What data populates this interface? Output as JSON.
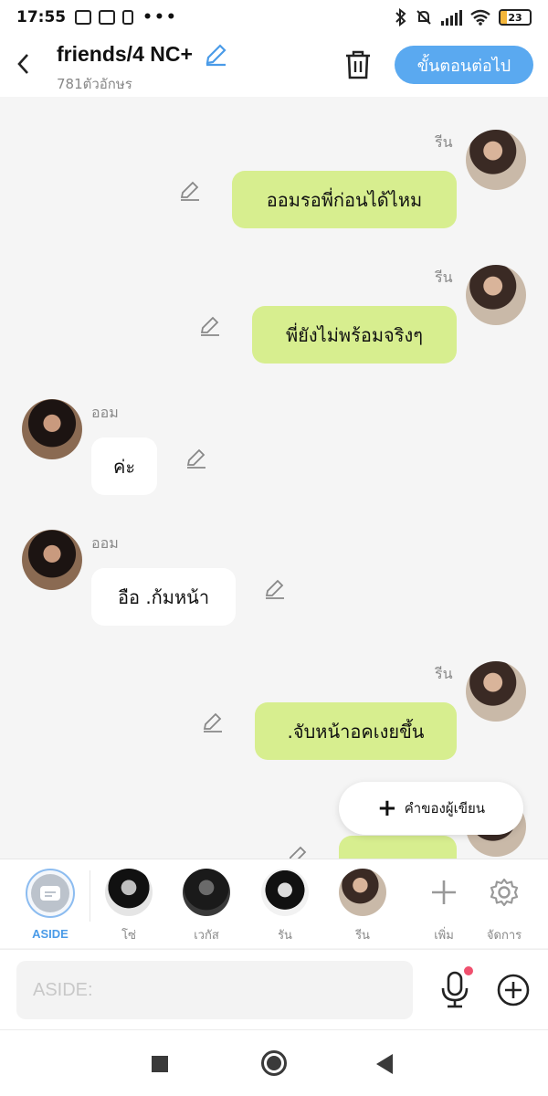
{
  "status": {
    "time": "17:55",
    "dots": "•••",
    "battery": "23",
    "battery_level": 0.23
  },
  "header": {
    "title": "friends/4 NC+",
    "subtitle": "781ตัวอักษร",
    "next_label": "ขั้นตอนต่อไป"
  },
  "messages": [
    {
      "sender": "รีน",
      "text": "ออมรอพี่ก่อนได้ไหม",
      "side": "me"
    },
    {
      "sender": "รีน",
      "text": "พี่ยังไม่พร้อมจริงๆ",
      "side": "me"
    },
    {
      "sender": "ออม",
      "text": "ค่ะ",
      "side": "them"
    },
    {
      "sender": "ออม",
      "text": "อือ .ก้มหน้า",
      "side": "them"
    },
    {
      "sender": "รีน",
      "text": ".จับหน้าอคเงยขึ้น",
      "side": "me"
    }
  ],
  "writer_button": {
    "label": "คำของผู้เขียน"
  },
  "characters": [
    {
      "label": "ASIDE"
    },
    {
      "label": "โซ่"
    },
    {
      "label": "เวกัส"
    },
    {
      "label": "รัน"
    },
    {
      "label": "รีน"
    }
  ],
  "tools": {
    "add_label": "เพิ่ม",
    "manage_label": "จัดการ"
  },
  "input": {
    "placeholder": "ASIDE:"
  },
  "colors": {
    "accent": "#5aa9f0",
    "my_bubble": "#d7ee8f",
    "their_bubble": "#ffffff",
    "mic_dot": "#f0506e"
  }
}
